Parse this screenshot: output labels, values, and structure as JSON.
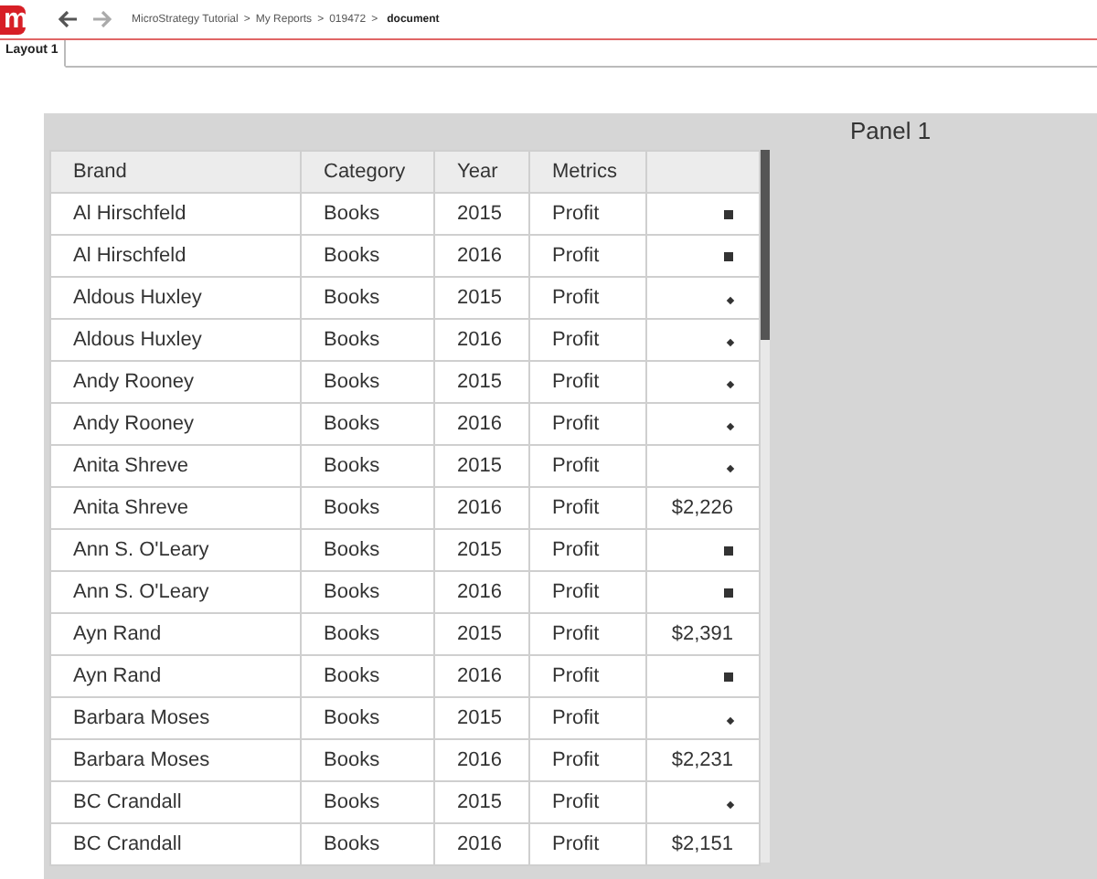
{
  "logo": "m",
  "breadcrumb": [
    {
      "label": "MicroStrategy Tutorial",
      "current": false
    },
    {
      "label": "My Reports",
      "current": false
    },
    {
      "label": "019472",
      "current": false
    },
    {
      "label": "document",
      "current": true
    }
  ],
  "breadcrumb_separator": ">",
  "tabs": [
    {
      "label": "Layout 1",
      "selected": true
    }
  ],
  "panel": {
    "title": "Panel 1"
  },
  "table": {
    "columns": [
      "Brand",
      "Category",
      "Year",
      "Metrics",
      ""
    ],
    "rows": [
      {
        "brand": "Al Hirschfeld",
        "category": "Books",
        "year": "2015",
        "metric": "Profit",
        "value": {
          "kind": "square"
        }
      },
      {
        "brand": "Al Hirschfeld",
        "category": "Books",
        "year": "2016",
        "metric": "Profit",
        "value": {
          "kind": "square"
        }
      },
      {
        "brand": "Aldous Huxley",
        "category": "Books",
        "year": "2015",
        "metric": "Profit",
        "value": {
          "kind": "diamond"
        }
      },
      {
        "brand": "Aldous Huxley",
        "category": "Books",
        "year": "2016",
        "metric": "Profit",
        "value": {
          "kind": "diamond"
        }
      },
      {
        "brand": "Andy Rooney",
        "category": "Books",
        "year": "2015",
        "metric": "Profit",
        "value": {
          "kind": "diamond"
        }
      },
      {
        "brand": "Andy Rooney",
        "category": "Books",
        "year": "2016",
        "metric": "Profit",
        "value": {
          "kind": "diamond"
        }
      },
      {
        "brand": "Anita Shreve",
        "category": "Books",
        "year": "2015",
        "metric": "Profit",
        "value": {
          "kind": "diamond"
        }
      },
      {
        "brand": "Anita Shreve",
        "category": "Books",
        "year": "2016",
        "metric": "Profit",
        "value": {
          "kind": "amount",
          "text": "$2,226"
        }
      },
      {
        "brand": "Ann S. O'Leary",
        "category": "Books",
        "year": "2015",
        "metric": "Profit",
        "value": {
          "kind": "square"
        }
      },
      {
        "brand": "Ann S. O'Leary",
        "category": "Books",
        "year": "2016",
        "metric": "Profit",
        "value": {
          "kind": "square"
        }
      },
      {
        "brand": "Ayn Rand",
        "category": "Books",
        "year": "2015",
        "metric": "Profit",
        "value": {
          "kind": "amount",
          "text": "$2,391"
        }
      },
      {
        "brand": "Ayn Rand",
        "category": "Books",
        "year": "2016",
        "metric": "Profit",
        "value": {
          "kind": "square"
        }
      },
      {
        "brand": "Barbara Moses",
        "category": "Books",
        "year": "2015",
        "metric": "Profit",
        "value": {
          "kind": "diamond"
        }
      },
      {
        "brand": "Barbara Moses",
        "category": "Books",
        "year": "2016",
        "metric": "Profit",
        "value": {
          "kind": "amount",
          "text": "$2,231"
        }
      },
      {
        "brand": "BC Crandall",
        "category": "Books",
        "year": "2015",
        "metric": "Profit",
        "value": {
          "kind": "diamond"
        }
      },
      {
        "brand": "BC Crandall",
        "category": "Books",
        "year": "2016",
        "metric": "Profit",
        "value": {
          "kind": "amount",
          "text": "$2,151"
        }
      }
    ]
  }
}
